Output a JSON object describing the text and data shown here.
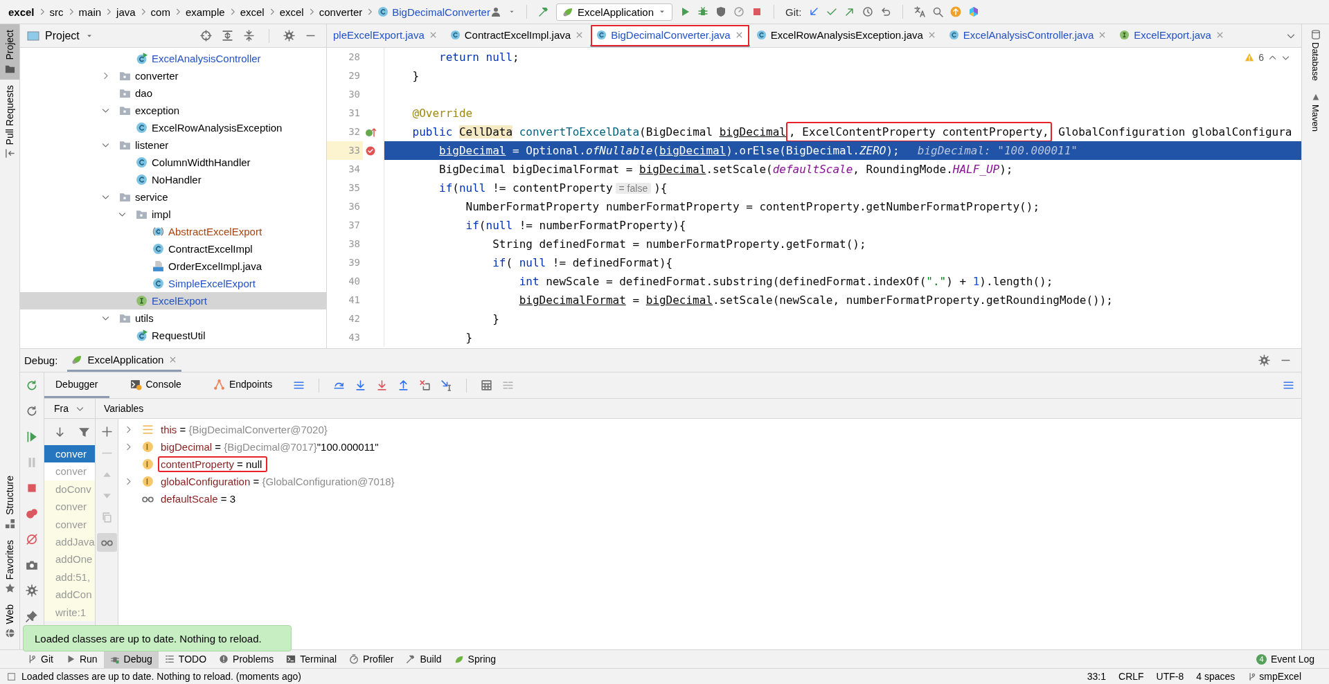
{
  "breadcrumbs": [
    {
      "label": "excel",
      "kind": "project"
    },
    {
      "label": "src",
      "kind": "dir"
    },
    {
      "label": "main",
      "kind": "dir"
    },
    {
      "label": "java",
      "kind": "dir"
    },
    {
      "label": "com",
      "kind": "dir"
    },
    {
      "label": "example",
      "kind": "dir"
    },
    {
      "label": "excel",
      "kind": "dir"
    },
    {
      "label": "excel",
      "kind": "dir"
    },
    {
      "label": "converter",
      "kind": "dir"
    },
    {
      "label": "BigDecimalConverter",
      "kind": "class"
    }
  ],
  "run_config": "ExcelApplication",
  "vcs_label": "Git:",
  "left_stripe": [
    {
      "label": "Project",
      "kind": "folder-dark",
      "selected": true
    },
    {
      "label": "Pull Requests",
      "kind": "pull",
      "selected": false
    }
  ],
  "left_stripe_bottom": [
    {
      "label": "Structure",
      "kind": "structure"
    },
    {
      "label": "Favorites",
      "kind": "star"
    },
    {
      "label": "Web",
      "kind": "globe"
    }
  ],
  "right_stripe": [
    {
      "label": "Database",
      "kind": "database"
    },
    {
      "label": "Maven",
      "kind": "maven"
    }
  ],
  "project_panel": {
    "title": "Project"
  },
  "tree": [
    {
      "children": [
        {
          "label": "ExcelAnalysisController",
          "kind": "class-run",
          "color": "#2151c4",
          "selected": false
        }
      ]
    },
    {
      "label": "converter",
      "kind": "folder",
      "expanded": false,
      "color": "#000000",
      "selected": false
    },
    {
      "label": "dao",
      "kind": "folder",
      "color": "#000000",
      "selected": false
    },
    {
      "label": "exception",
      "kind": "folder",
      "expanded": true,
      "color": "#000000",
      "selected": false,
      "children": [
        {
          "label": "ExcelRowAnalysisException",
          "kind": "class",
          "color": "#000000",
          "selected": false
        }
      ]
    },
    {
      "label": "listener",
      "kind": "folder",
      "expanded": true,
      "color": "#000000",
      "selected": false,
      "children": [
        {
          "label": "ColumnWidthHandler",
          "kind": "class",
          "color": "#000000",
          "selected": false
        },
        {
          "label": "NoHandler",
          "kind": "class",
          "color": "#000000",
          "selected": false
        }
      ]
    },
    {
      "label": "service",
      "kind": "folder",
      "expanded": true,
      "color": "#000000",
      "selected": false,
      "children": [
        {
          "label": "impl",
          "kind": "folder",
          "expanded": true,
          "color": "#000000",
          "selected": false,
          "children": [
            {
              "label": "AbstractExcelExport",
              "kind": "abstract",
              "color": "#a8420f",
              "selected": false
            },
            {
              "label": "ContractExcelImpl",
              "kind": "class",
              "color": "#000000",
              "selected": false
            },
            {
              "label": "OrderExcelImpl.java",
              "kind": "java-file",
              "color": "#000000",
              "selected": false
            },
            {
              "label": "SimpleExcelExport",
              "kind": "class",
              "color": "#2151c4",
              "selected": false
            }
          ]
        },
        {
          "label": "ExcelExport",
          "kind": "interface",
          "color": "#2151c4",
          "selected": true
        }
      ]
    },
    {
      "label": "utils",
      "kind": "folder",
      "expanded": true,
      "color": "#000000",
      "selected": false,
      "children": [
        {
          "label": "RequestUtil",
          "kind": "class-run",
          "color": "#000000",
          "selected": false
        }
      ]
    }
  ],
  "tabs": [
    {
      "label": "pleExcelExport.java",
      "kind": "plain",
      "color": "#2151c4",
      "selected": false,
      "boxed": false
    },
    {
      "label": "ContractExcelImpl.java",
      "kind": "class",
      "color": "#000000",
      "selected": false,
      "boxed": false
    },
    {
      "label": "BigDecimalConverter.java",
      "kind": "class",
      "color": "#2151c4",
      "selected": true,
      "boxed": true
    },
    {
      "label": "ExcelRowAnalysisException.java",
      "kind": "class",
      "color": "#000000",
      "selected": false,
      "boxed": false
    },
    {
      "label": "ExcelAnalysisController.java",
      "kind": "class",
      "color": "#2151c4",
      "selected": false,
      "boxed": false
    },
    {
      "label": "ExcelExport.java",
      "kind": "interface",
      "color": "#2151c4",
      "selected": false,
      "boxed": false
    }
  ],
  "editor": {
    "problems": "6",
    "lines": [
      {
        "number": "28",
        "kind": "plain",
        "selected": false,
        "tokens": [
          {
            "t": "        return",
            "kind": "kw"
          },
          {
            "t": " null",
            "kind": "kw"
          },
          {
            "t": ";",
            "kind": "p"
          }
        ]
      },
      {
        "number": "29",
        "kind": "plain",
        "selected": false,
        "tokens": [
          {
            "t": "    }",
            "kind": "p"
          }
        ]
      },
      {
        "number": "30",
        "kind": "plain",
        "selected": false
      },
      {
        "number": "31",
        "kind": "plain",
        "selected": false,
        "tokens": [
          {
            "t": "    @Override",
            "kind": "ann"
          }
        ]
      },
      {
        "number": "32",
        "kind": "override",
        "selected": false,
        "tokens": [
          {
            "t": "    public ",
            "kind": "kw"
          },
          {
            "t": "CellData",
            "kind": "hl"
          },
          {
            "t": " convertToExcelData",
            "kind": "decl"
          },
          {
            "t": "(BigDecimal ",
            "kind": "p"
          },
          {
            "t": "bigDecimal",
            "kind": "u"
          },
          {
            "t": ", ExcelContentProperty contentProperty,",
            "kind": "boxed"
          },
          {
            "t": " GlobalConfiguration globalConfigura",
            "kind": "p"
          }
        ]
      },
      {
        "number": "33",
        "kind": "breakpoint",
        "selected": true,
        "tokens": [
          {
            "t": "        bigDecimal",
            "kind": "u"
          },
          {
            "t": " = Optional.",
            "kind": "p"
          },
          {
            "t": "ofNullable",
            "kind": "i"
          },
          {
            "t": "(",
            "kind": "p"
          },
          {
            "t": "bigDecimal",
            "kind": "u"
          },
          {
            "t": ").orElse(BigDecimal.",
            "kind": "p"
          },
          {
            "t": "ZERO",
            "kind": "st"
          },
          {
            "t": ");",
            "kind": "p"
          },
          {
            "t": "bigDecimal: \"100.000011\"",
            "kind": "val"
          }
        ]
      },
      {
        "number": "34",
        "kind": "plain",
        "selected": false,
        "tokens": [
          {
            "t": "        BigDecimal bigDecimalFormat = ",
            "kind": "p"
          },
          {
            "t": "bigDecimal",
            "kind": "u"
          },
          {
            "t": ".setScale(",
            "kind": "p"
          },
          {
            "t": "defaultScale",
            "kind": "st"
          },
          {
            "t": ", RoundingMode.",
            "kind": "p"
          },
          {
            "t": "HALF_UP",
            "kind": "st"
          },
          {
            "t": ");",
            "kind": "p"
          }
        ]
      },
      {
        "number": "35",
        "kind": "plain",
        "selected": false,
        "tokens": [
          {
            "t": "        if",
            "kind": "kw"
          },
          {
            "t": "(",
            "kind": "p"
          },
          {
            "t": "null",
            "kind": "kw"
          },
          {
            "t": " != contentProperty",
            "kind": "p"
          },
          {
            "t": "= false",
            "kind": "hint"
          },
          {
            "t": "){",
            "kind": "p"
          }
        ]
      },
      {
        "number": "36",
        "kind": "plain",
        "selected": false,
        "tokens": [
          {
            "t": "            NumberFormatProperty numberFormatProperty = contentProperty.getNumberFormatProperty();",
            "kind": "p"
          }
        ]
      },
      {
        "number": "37",
        "kind": "plain",
        "selected": false,
        "tokens": [
          {
            "t": "            if",
            "kind": "kw"
          },
          {
            "t": "(",
            "kind": "p"
          },
          {
            "t": "null",
            "kind": "kw"
          },
          {
            "t": " != numberFormatProperty){",
            "kind": "p"
          }
        ]
      },
      {
        "number": "38",
        "kind": "plain",
        "selected": false,
        "tokens": [
          {
            "t": "                String definedFormat = numberFormatProperty.getFormat();",
            "kind": "p"
          }
        ]
      },
      {
        "number": "39",
        "kind": "plain",
        "selected": false,
        "tokens": [
          {
            "t": "                if",
            "kind": "kw"
          },
          {
            "t": "( ",
            "kind": "p"
          },
          {
            "t": "null",
            "kind": "kw"
          },
          {
            "t": " != definedFormat){",
            "kind": "p"
          }
        ]
      },
      {
        "number": "40",
        "kind": "plain",
        "selected": false,
        "tokens": [
          {
            "t": "                    int",
            "kind": "kw"
          },
          {
            "t": " newScale = definedFormat.substring(definedFormat.indexOf(",
            "kind": "p"
          },
          {
            "t": "\".\"",
            "kind": "str"
          },
          {
            "t": ") + ",
            "kind": "p"
          },
          {
            "t": "1",
            "kind": "num"
          },
          {
            "t": ").length();",
            "kind": "p"
          }
        ]
      },
      {
        "number": "41",
        "kind": "plain",
        "selected": false,
        "tokens": [
          {
            "t": "                    bigDecimalFormat",
            "kind": "u"
          },
          {
            "t": " = ",
            "kind": "p"
          },
          {
            "t": "bigDecimal",
            "kind": "u"
          },
          {
            "t": ".setScale(newScale, numberFormatProperty.getRoundingMode());",
            "kind": "p"
          }
        ]
      },
      {
        "number": "42",
        "kind": "plain",
        "selected": false,
        "tokens": [
          {
            "t": "                }",
            "kind": "p"
          }
        ]
      },
      {
        "number": "43",
        "kind": "plain",
        "selected": false,
        "tokens": [
          {
            "t": "            }",
            "kind": "p"
          }
        ]
      }
    ]
  },
  "debug": {
    "label": "Debug:",
    "session": "ExcelApplication",
    "tabs": [
      {
        "label": "Debugger",
        "kind": "plain",
        "selected": true
      },
      {
        "label": "Console",
        "kind": "console",
        "selected": false
      },
      {
        "label": "Endpoints",
        "kind": "endpoints",
        "selected": false
      }
    ],
    "frames_label": "Fra",
    "variables_label": "Variables",
    "frames": [
      {
        "label": "conver",
        "selected": true,
        "library": false
      },
      {
        "label": "conver",
        "selected": false,
        "library": false
      },
      {
        "label": "doConv",
        "selected": false,
        "library": true
      },
      {
        "label": "conver",
        "selected": false,
        "library": true
      },
      {
        "label": "conver",
        "selected": false,
        "library": true
      },
      {
        "label": "addJava",
        "selected": false,
        "library": true
      },
      {
        "label": "addOne",
        "selected": false,
        "library": true
      },
      {
        "label": "add:51,",
        "selected": false,
        "library": true
      },
      {
        "label": "addCon",
        "selected": false,
        "library": true
      },
      {
        "label": "write:1",
        "selected": false,
        "library": true
      }
    ],
    "variables": [
      {
        "kind": "fields",
        "name": "this",
        "operator": "=",
        "ref": "{BigDecimalConverter@7020}",
        "expandable": true,
        "boxed": false
      },
      {
        "kind": "param",
        "name": "bigDecimal",
        "operator": "=",
        "ref": "{BigDecimal@7017}",
        "value": "\"100.000011\"",
        "expandable": true,
        "boxed": false
      },
      {
        "kind": "param",
        "name": "contentProperty",
        "operator": "=",
        "value": "null",
        "expandable": false,
        "boxed": true
      },
      {
        "kind": "param",
        "name": "globalConfiguration",
        "operator": "=",
        "ref": "{GlobalConfiguration@7018}",
        "expandable": true,
        "boxed": false
      },
      {
        "kind": "glasses",
        "name": "defaultScale",
        "operator": "=",
        "value": "3",
        "expandable": false,
        "boxed": false
      }
    ]
  },
  "notification": "Loaded classes are up to date. Nothing to reload.",
  "tool_windows": [
    {
      "label": "Git",
      "kind": "git",
      "selected": false
    },
    {
      "label": "Run",
      "kind": "runb",
      "selected": false
    },
    {
      "label": "Debug",
      "kind": "debugb",
      "selected": true
    },
    {
      "label": "TODO",
      "kind": "todo",
      "selected": false
    },
    {
      "label": "Problems",
      "kind": "problems",
      "selected": false
    },
    {
      "label": "Terminal",
      "kind": "terminal",
      "selected": false
    },
    {
      "label": "Profiler",
      "kind": "profiler",
      "selected": false
    },
    {
      "label": "Build",
      "kind": "build",
      "selected": false
    },
    {
      "label": "Spring",
      "kind": "spring",
      "selected": false
    }
  ],
  "event_log": {
    "label": "Event Log",
    "count": "4"
  },
  "status_bar": {
    "message": "Loaded classes are up to date. Nothing to reload. (moments ago)",
    "position": "33:1",
    "line_separator": "CRLF",
    "encoding": "UTF-8",
    "indent": "4 spaces",
    "branch": "smpExcel"
  }
}
